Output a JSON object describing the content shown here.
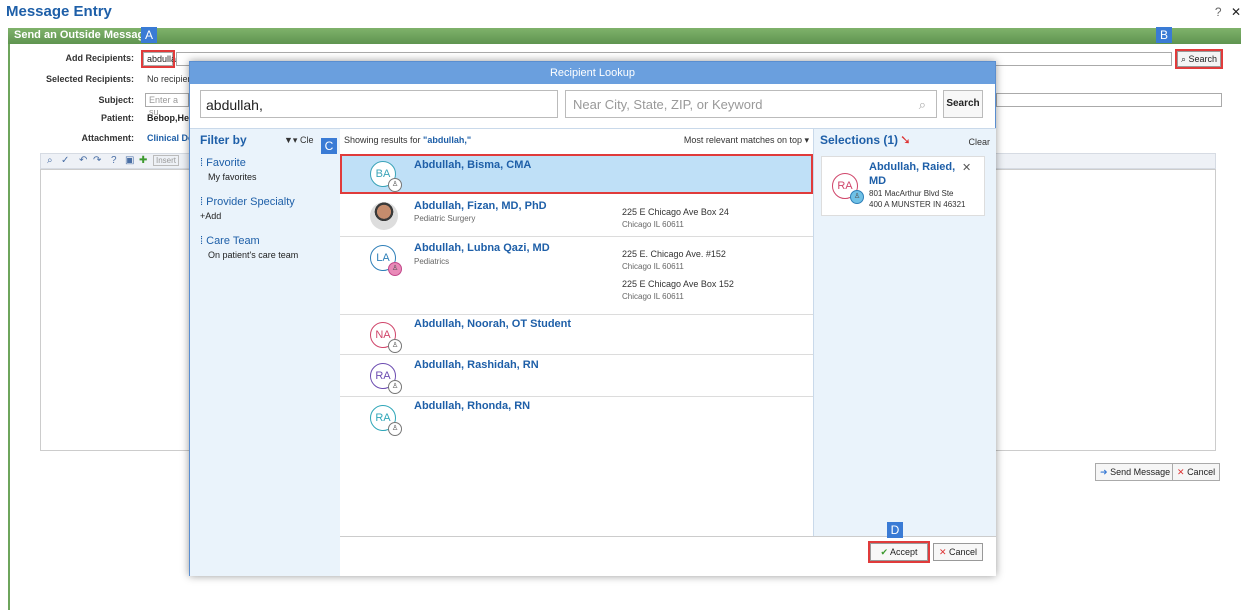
{
  "window": {
    "title": "Message Entry",
    "help_icon": "?",
    "close_icon": "✕"
  },
  "section_header": "Send an Outside Message",
  "badges": {
    "a": "A",
    "b": "B",
    "c": "C",
    "d": "D"
  },
  "form": {
    "add_recipients_label": "Add Recipients:",
    "add_recipients_value": "abdullah,",
    "search_button": "Search",
    "selected_recipients_label": "Selected Recipients:",
    "selected_recipients_value": "No recipien",
    "subject_label": "Subject:",
    "subject_placeholder": "Enter a su",
    "patient_label": "Patient:",
    "patient_value": "Bebop,Hea",
    "attachment_label": "Attachment:",
    "attachment_value": "Clinical Do",
    "toolbar_insert": "Insert"
  },
  "actions": {
    "send_message": "Send Message",
    "cancel": "Cancel"
  },
  "modal": {
    "title": "Recipient Lookup",
    "search_value": "abdullah,",
    "location_placeholder": "Near City, State, ZIP, or Keyword",
    "search_button": "Search",
    "filter_by": "Filter by",
    "filter_clear": "Cle",
    "filters": [
      {
        "section": "Favorite",
        "item": "My favorites"
      },
      {
        "section": "Provider Specialty",
        "item": "+Add"
      },
      {
        "section": "Care Team",
        "item": "On patient's care team"
      }
    ],
    "results_prefix": "Showing results for ",
    "results_query": "\"abdullah,\"",
    "sort_label": "Most relevant matches on top ▾",
    "results": [
      {
        "initials": "BA",
        "name": "Abdullah, Bisma, CMA",
        "specialty": "",
        "addr1": "",
        "city1": "",
        "addr2": "",
        "city2": "",
        "color": "#3aa3b8"
      },
      {
        "initials": "",
        "name": "Abdullah, Fizan, MD, PhD",
        "specialty": "Pediatric Surgery",
        "addr1": "225 E Chicago Ave Box 24",
        "city1": "Chicago IL 60611",
        "addr2": "",
        "city2": "",
        "color": "#666"
      },
      {
        "initials": "LA",
        "name": "Abdullah, Lubna Qazi, MD",
        "specialty": "Pediatrics",
        "addr1": "225 E. Chicago Ave. #152",
        "city1": "Chicago IL 60611",
        "addr2": "225 E Chicago Ave Box 152",
        "city2": "Chicago IL 60611",
        "color": "#2e7fb8"
      },
      {
        "initials": "NA",
        "name": "Abdullah, Noorah, OT Student",
        "specialty": "",
        "addr1": "",
        "city1": "",
        "addr2": "",
        "city2": "",
        "color": "#d0456a"
      },
      {
        "initials": "RA",
        "name": "Abdullah, Rashidah, RN",
        "specialty": "",
        "addr1": "",
        "city1": "",
        "addr2": "",
        "city2": "",
        "color": "#6b4bb0"
      },
      {
        "initials": "RA",
        "name": "Abdullah, Rhonda, RN",
        "specialty": "",
        "addr1": "",
        "city1": "",
        "addr2": "",
        "city2": "",
        "color": "#2ea6b8"
      }
    ],
    "selections_title": "Selections (1)",
    "selections_clear": "Clear",
    "selection": {
      "initials": "RA",
      "name_line1": "Abdullah, Raied,",
      "name_line2": "MD",
      "addr_line1": "801 MacArthur Blvd Ste",
      "addr_line2": "400 A MUNSTER IN 46321",
      "color": "#d0456a"
    },
    "accept": "Accept",
    "cancel": "Cancel"
  },
  "colors": {
    "title_blue": "#1e5fa8",
    "header_green": "#6ea55c",
    "modal_blue": "#6a9fde",
    "highlight_red": "#e03b3b",
    "selected_row": "#bfe0f7"
  }
}
